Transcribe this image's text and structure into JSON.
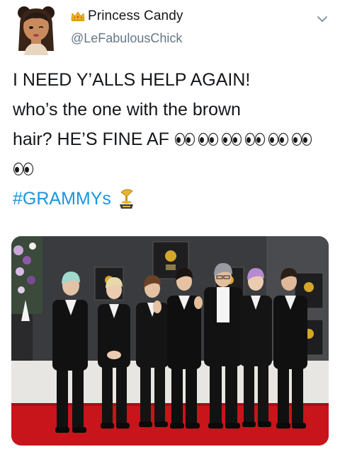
{
  "user": {
    "display_name": "Princess Candy",
    "handle": "@LeFabulousChick"
  },
  "tweet": {
    "lines": [
      "I NEED Y’ALLS HELP AGAIN!",
      "who’s the one with the brown",
      "hair? HE’S FINE AF"
    ],
    "eyes_emoji_count_line3": 6,
    "eyes_emoji_count_line4": 1,
    "hashtag": "#GRAMMYs"
  },
  "icons": {
    "crown": "crown-emoji",
    "eyes": "eyes-emoji",
    "trophy": "gramophone-trophy-emoji",
    "more": "chevron-down-icon"
  },
  "colors": {
    "text": "#14171a",
    "muted": "#657786",
    "link": "#1b95e0",
    "carpet": "#c8141b"
  }
}
